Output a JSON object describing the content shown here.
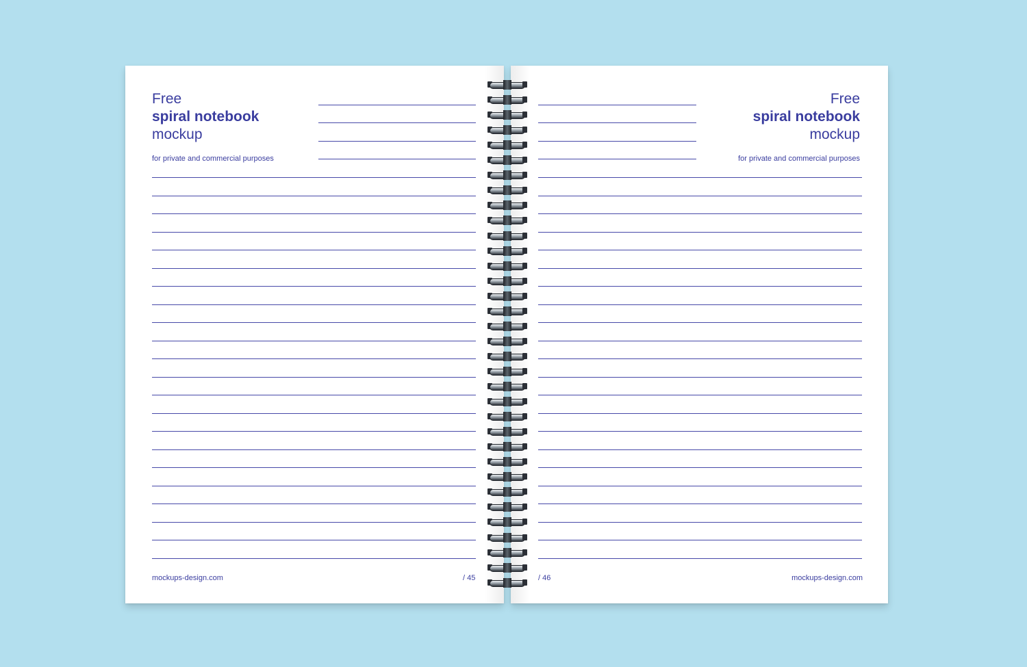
{
  "left_page": {
    "title_line1": "Free",
    "title_line2": "spiral notebook",
    "title_line3": "mockup",
    "subtitle": "for private and commercial purposes",
    "footer_site": "mockups-design.com",
    "page_number": "/ 45"
  },
  "right_page": {
    "title_line1": "Free",
    "title_line2": "spiral notebook",
    "title_line3": "mockup",
    "subtitle": "for private and commercial purposes",
    "footer_site": "mockups-design.com",
    "page_number": "/ 46"
  },
  "colors": {
    "background": "#b3dfee",
    "paper": "#ffffff",
    "ink": "#3a3d9f",
    "rule_line": "#4648a8"
  }
}
